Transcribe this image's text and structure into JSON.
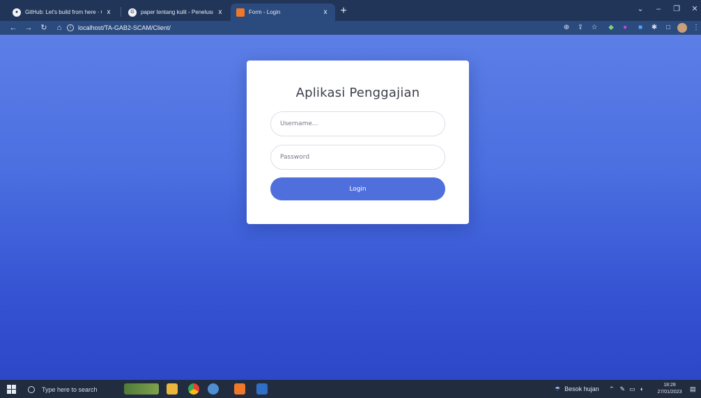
{
  "browser": {
    "tabs": [
      {
        "title": "GitHub: Let's build from here · G",
        "icon": "github-icon",
        "close": "x"
      },
      {
        "title": "paper tentang kulit - Penelusuran",
        "icon": "google-icon",
        "close": "x"
      },
      {
        "title": "Form - Login",
        "icon": "xampp-icon",
        "close": "x",
        "active": true
      }
    ],
    "new_tab": "+",
    "url": "localhost/TA-GAB2-SCAM/Client/"
  },
  "page": {
    "title": "Aplikasi Penggajian",
    "username_placeholder": "Username...",
    "password_placeholder": "Password",
    "login_label": "Login",
    "accent_color": "#4f6fdc"
  },
  "taskbar": {
    "search_placeholder": "Type here to search",
    "weather": "Besok hujan",
    "time": "18:28",
    "date": "27/01/2023"
  }
}
